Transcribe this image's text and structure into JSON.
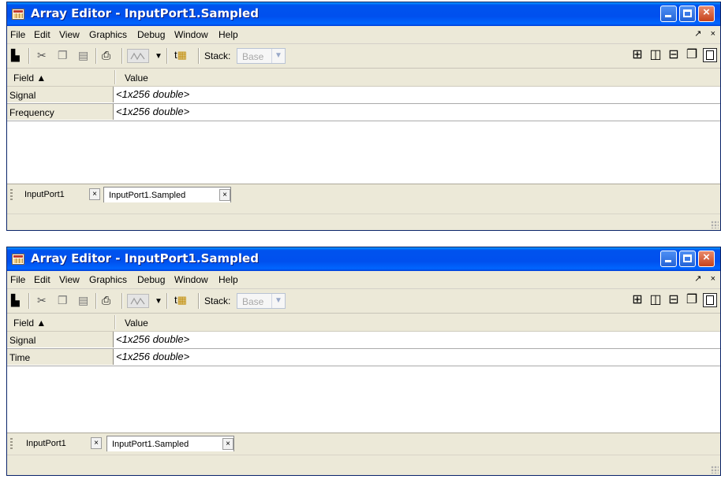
{
  "windows": [
    {
      "title": "Array Editor - InputPort1.Sampled",
      "menu": [
        "File",
        "Edit",
        "View",
        "Graphics",
        "Debug",
        "Window",
        "Help"
      ],
      "menu_right": [
        "↗",
        "×"
      ],
      "toolbar": {
        "stack_label": "Stack:",
        "stack_value": "Base"
      },
      "grid": {
        "columns": [
          "Field ▲",
          "Value"
        ],
        "rows": [
          {
            "field": "Signal",
            "value": "<1x256 double>"
          },
          {
            "field": "Frequency",
            "value": "<1x256 double>"
          }
        ]
      },
      "tabs": [
        {
          "label": "InputPort1",
          "close": "×"
        },
        {
          "label": "InputPort1.Sampled",
          "close": "×",
          "selected": true
        }
      ]
    },
    {
      "title": "Array Editor - InputPort1.Sampled",
      "menu": [
        "File",
        "Edit",
        "View",
        "Graphics",
        "Debug",
        "Window",
        "Help"
      ],
      "menu_right": [
        "↗",
        "×"
      ],
      "toolbar": {
        "stack_label": "Stack:",
        "stack_value": "Base"
      },
      "grid": {
        "columns": [
          "Field ▲",
          "Value"
        ],
        "rows": [
          {
            "field": "Signal",
            "value": "<1x256 double>"
          },
          {
            "field": "Time",
            "value": "<1x256 double>"
          }
        ]
      },
      "tabs": [
        {
          "label": "InputPort1",
          "close": "×"
        },
        {
          "label": "InputPort1.Sampled",
          "close": "×",
          "selected": true
        }
      ]
    }
  ],
  "icons": {
    "title": "array-editor-icon",
    "toolbar": [
      "import-data-icon",
      "cut-icon",
      "copy-icon",
      "paste-icon",
      "print-icon",
      "plot-icon",
      "dropdown-arrow-icon",
      "stack-up-icon"
    ],
    "layout": [
      "tile-icon",
      "left-right-split-icon",
      "top-bottom-split-icon",
      "float-icon",
      "maximize-icon"
    ]
  },
  "colors": {
    "titlebar": "#0053ee",
    "close_button": "#c6431d",
    "chrome": "#ece9d8"
  }
}
